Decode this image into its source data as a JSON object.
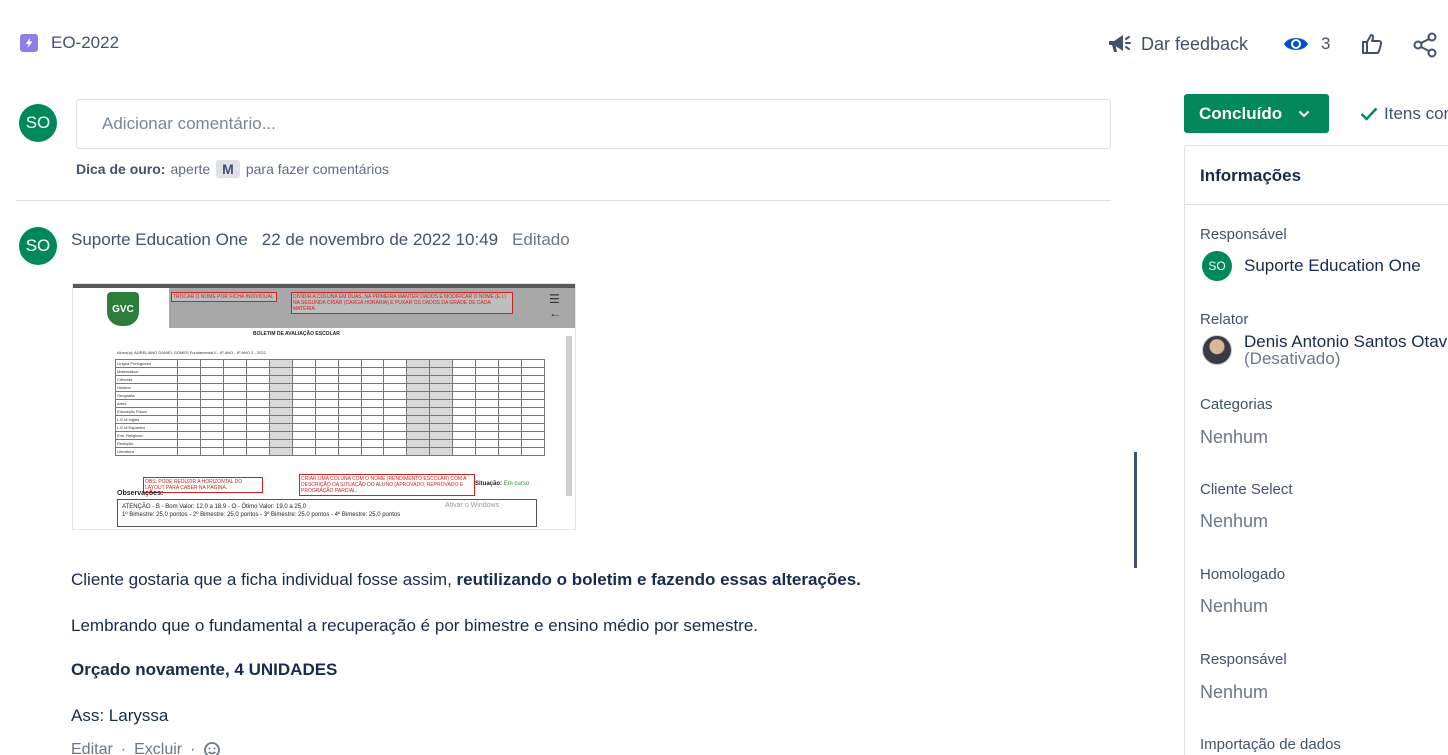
{
  "header": {
    "issue_key": "EO-2022",
    "issue_type_icon": "lightning-icon",
    "feedback_label": "Dar feedback",
    "watchers_count": "3"
  },
  "composer": {
    "avatar_initials": "SO",
    "placeholder": "Adicionar comentário...",
    "tip_bold": "Dica de ouro:",
    "tip_pre": "aperte",
    "tip_key": "M",
    "tip_post": "para fazer comentários"
  },
  "comment": {
    "avatar_initials": "SO",
    "author": "Suporte Education One",
    "date": "22 de novembro de 2022 10:49",
    "edited": "Editado",
    "paragraph1_pre": "Cliente gostaria que a ficha individual fosse assim, ",
    "paragraph1_bold": "reutilizando o boletim e fazendo essas alterações.",
    "paragraph2": "Lembrando que o fundamental a recuperação é por bimestre e ensino médio por semestre.",
    "paragraph3": "Orçado novamente, 4 UNIDADES",
    "paragraph4": "Ass: Laryssa",
    "action_edit": "Editar",
    "action_delete": "Excluir",
    "attachment": {
      "logo": "GVC",
      "note1": "TROCAR O NOME POR FICHA INDIVIDUAL",
      "note2": "DIVIDIR A COLUNA EM DUAS, NA PRIMEIRA MANTER DADOS E MODIFICAR O NOME (E.I.) NA SEGUNDA CRIAR (CARGA HORÁRIA) E PUXAR OS DADOS DA GRADE DE CADA MATÉRIA",
      "note3": "OBS: PODE REDUZIR A HORIZONTAL DO LAYOUT PARA CABER NA PÁGINA.",
      "note4": "CRIAR UMA COLUNA COM O NOME (RENDIMENTO ESCOLAR) COM A DESCRIÇÃO DA SITUAÇÃO DO ALUNO (APROVADO, REPROVADO E PROGRAÇÃO PARCIAL.",
      "title": "BOLETIM DE AVALIAÇÃO ESCOLAR",
      "student_line": "Aluno(a): AURELIANO DANIEL GOMES          Fundamental II - 6º ANO - 6º ANO 2 - 2022",
      "obs_label": "Observações:",
      "obs_line1": "ATENÇÃO - B - Bom Valor: 12,0 a 18,9 - O - Ótimo Valor: 19,0 a 25,0",
      "obs_line2": "1º Bimestre: 25,0 pontos - 2º Bimestre: 25,0 pontos - 3º Bimestre: 25,0 pontos - 4º Bimestre: 25,0 pontos",
      "situation_label": "Situação:",
      "situation_value": "Em curso",
      "watermark": "Ativar o Windows",
      "subjects": [
        "Língua Portuguesa",
        "Matemática",
        "Ciências",
        "História",
        "Geografia",
        "Artes",
        "Educação Física",
        "L.E.M Inglês",
        "L.E.M Espanhol",
        "Ens. Religioso",
        "Redação",
        "Literatura"
      ]
    }
  },
  "sidebar": {
    "status_label": "Concluído",
    "items_label": "Itens con",
    "panel_title": "Informações",
    "fields": [
      {
        "label": "Responsável",
        "person": "Suporte Education One",
        "initials": "SO"
      },
      {
        "label": "Relator",
        "person": "Denis Antonio Santos Otav",
        "sub": "(Desativado)"
      },
      {
        "label": "Categorias",
        "value": "Nenhum"
      },
      {
        "label": "Cliente Select",
        "value": "Nenhum"
      },
      {
        "label": "Homologado",
        "value": "Nenhum"
      },
      {
        "label": "Responsável",
        "value": "Nenhum"
      },
      {
        "label": "Importação de dados"
      }
    ]
  }
}
